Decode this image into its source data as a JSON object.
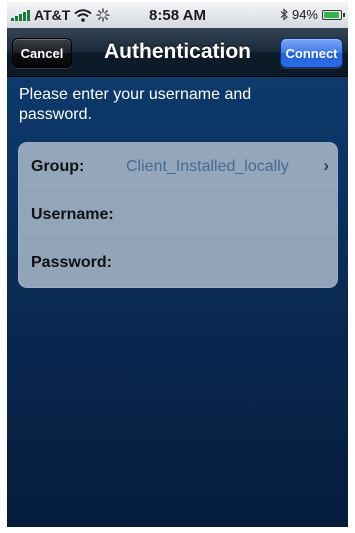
{
  "status_bar": {
    "carrier": "AT&T",
    "time": "8:58 AM",
    "battery": "94%",
    "battery_level": 0.94,
    "icons": [
      "signal-icon",
      "wifi-icon",
      "activity-spinner-icon",
      "bluetooth-icon",
      "battery-icon"
    ]
  },
  "nav": {
    "title": "Authentication",
    "cancel_label": "Cancel",
    "connect_label": "Connect"
  },
  "form": {
    "prompt": "Please enter your username and password.",
    "group_label": "Group:",
    "group_value": "Client_Installed_locally",
    "username_label": "Username:",
    "username_value": "",
    "password_label": "Password:",
    "password_value": ""
  },
  "colors": {
    "connect_button": "#2a6ce6",
    "background": "#0a2d58",
    "group_value_text": "#4a6a90"
  }
}
